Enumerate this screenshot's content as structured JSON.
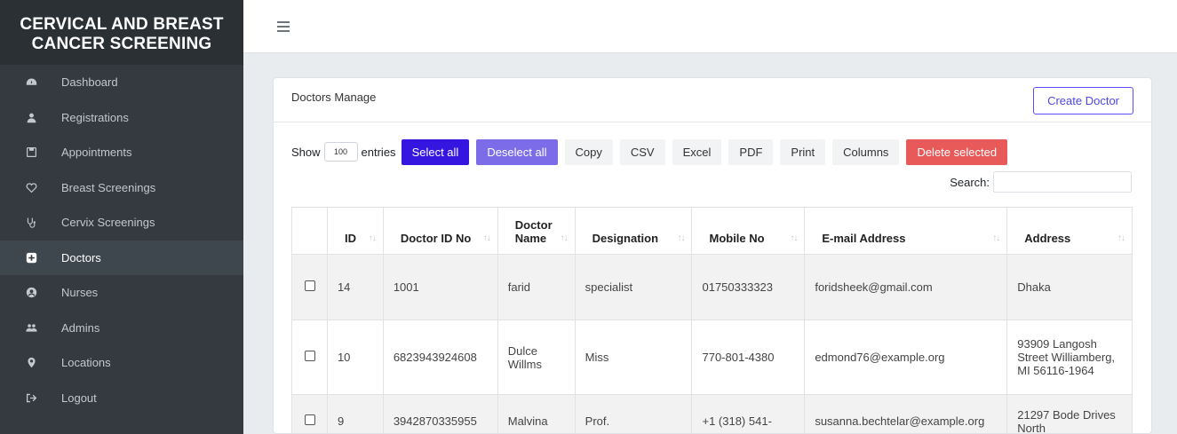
{
  "brand": {
    "line1": "CERVICAL AND BREAST",
    "line2": "CANCER SCREENING"
  },
  "sidebar": {
    "items": [
      {
        "label": "Dashboard",
        "icon": "dashboard-icon",
        "active": false
      },
      {
        "label": "Registrations",
        "icon": "user-icon",
        "active": false
      },
      {
        "label": "Appointments",
        "icon": "save-icon",
        "active": false
      },
      {
        "label": "Breast Screenings",
        "icon": "heart-icon",
        "active": false
      },
      {
        "label": "Cervix Screenings",
        "icon": "stethoscope-icon",
        "active": false
      },
      {
        "label": "Doctors",
        "icon": "plus-square-icon",
        "active": true
      },
      {
        "label": "Nurses",
        "icon": "user-circle-icon",
        "active": false
      },
      {
        "label": "Admins",
        "icon": "users-icon",
        "active": false
      },
      {
        "label": "Locations",
        "icon": "map-marker-icon",
        "active": false
      },
      {
        "label": "Logout",
        "icon": "sign-out-icon",
        "active": false
      }
    ]
  },
  "card": {
    "title": "Doctors Manage",
    "create_label": "Create Doctor"
  },
  "toolbar": {
    "show": "Show",
    "length_value": "100",
    "entries": "entries",
    "select_all": "Select all",
    "deselect_all": "Deselect all",
    "copy": "Copy",
    "csv": "CSV",
    "excel": "Excel",
    "pdf": "PDF",
    "print": "Print",
    "columns": "Columns",
    "delete_selected": "Delete selected"
  },
  "search": {
    "label": "Search:",
    "value": ""
  },
  "table": {
    "columns": [
      {
        "label": "",
        "width": 40
      },
      {
        "label": "ID",
        "width": 63
      },
      {
        "label": "Doctor ID No",
        "width": 129
      },
      {
        "label": "Doctor Name",
        "width": 87
      },
      {
        "label": "Designation",
        "width": 132
      },
      {
        "label": "Mobile No",
        "width": 127
      },
      {
        "label": "E-mail Address",
        "width": 228
      },
      {
        "label": "Address",
        "width": 141
      }
    ],
    "rows": [
      {
        "id": "14",
        "doctor_id_no": "1001",
        "doctor_name": "farid",
        "designation": "specialist",
        "mobile": "01750333323",
        "email": "foridsheek@gmail.com",
        "address": "Dhaka"
      },
      {
        "id": "10",
        "doctor_id_no": "6823943924608",
        "doctor_name": "Dulce Willms",
        "designation": "Miss",
        "mobile": "770-801-4380",
        "email": "edmond76@example.org",
        "address": "93909 Langosh Street Williamberg, MI 56116-1964"
      },
      {
        "id": "9",
        "doctor_id_no": "3942870335955",
        "doctor_name": "Malvina",
        "designation": "Prof.",
        "mobile": "+1 (318) 541-",
        "email": "susanna.bechtelar@example.org",
        "address": "21297 Bode Drives North"
      }
    ]
  }
}
